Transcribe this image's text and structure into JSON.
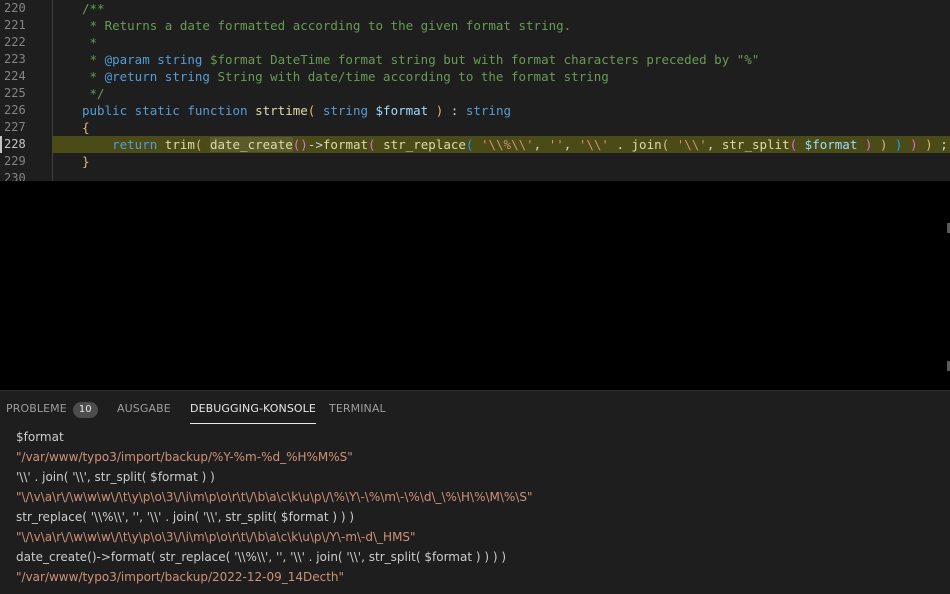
{
  "editor": {
    "lines": [
      {
        "num": "220",
        "segments": [
          {
            "cls": "c-comment",
            "text": "/**"
          }
        ]
      },
      {
        "num": "221",
        "segments": [
          {
            "cls": "c-comment",
            "text": " * Returns a date formatted according to the given format string."
          }
        ]
      },
      {
        "num": "222",
        "segments": [
          {
            "cls": "c-comment",
            "text": " *"
          }
        ]
      },
      {
        "num": "223",
        "segments": [
          {
            "cls": "c-comment",
            "text": " * "
          },
          {
            "cls": "c-doc-tag",
            "text": "@param"
          },
          {
            "cls": "c-comment",
            "text": " "
          },
          {
            "cls": "c-kw",
            "text": "string"
          },
          {
            "cls": "c-comment",
            "text": " $format DateTime format string but with format characters preceded by \"%\""
          }
        ]
      },
      {
        "num": "224",
        "segments": [
          {
            "cls": "c-comment",
            "text": " * "
          },
          {
            "cls": "c-doc-tag",
            "text": "@return"
          },
          {
            "cls": "c-comment",
            "text": " "
          },
          {
            "cls": "c-kw",
            "text": "string"
          },
          {
            "cls": "c-comment",
            "text": " String with date/time according to the format string"
          }
        ]
      },
      {
        "num": "225",
        "segments": [
          {
            "cls": "c-comment",
            "text": " */"
          }
        ]
      },
      {
        "num": "226",
        "segments": [
          {
            "cls": "c-kw",
            "text": "public static function "
          },
          {
            "cls": "c-fn",
            "text": "strtime"
          },
          {
            "cls": "c-brace",
            "text": "( "
          },
          {
            "cls": "c-kw",
            "text": "string "
          },
          {
            "cls": "c-var",
            "text": "$format"
          },
          {
            "cls": "c-brace",
            "text": " )"
          },
          {
            "cls": "c-op",
            "text": " : "
          },
          {
            "cls": "c-kw",
            "text": "string"
          }
        ]
      },
      {
        "num": "227",
        "segments": [
          {
            "cls": "c-brace",
            "text": "{"
          }
        ]
      },
      {
        "num": "228",
        "highlight": true,
        "segments": [
          {
            "cls": "c-op",
            "text": "    "
          },
          {
            "cls": "c-kw",
            "text": "return "
          },
          {
            "cls": "c-fn",
            "text": "trim"
          },
          {
            "cls": "c-brace",
            "text": "( "
          },
          {
            "cls": "c-fn hl-word",
            "text": "date_create"
          },
          {
            "cls": "c-brace2",
            "text": "()"
          },
          {
            "cls": "c-op",
            "text": "->"
          },
          {
            "cls": "c-fn",
            "text": "format"
          },
          {
            "cls": "c-brace2",
            "text": "( "
          },
          {
            "cls": "c-fn",
            "text": "str_replace"
          },
          {
            "cls": "c-brace3",
            "text": "( "
          },
          {
            "cls": "c-str",
            "text": "'\\\\%\\\\'"
          },
          {
            "cls": "c-op",
            "text": ", "
          },
          {
            "cls": "c-str",
            "text": "''"
          },
          {
            "cls": "c-op",
            "text": ", "
          },
          {
            "cls": "c-str",
            "text": "'\\\\'"
          },
          {
            "cls": "c-op",
            "text": " . "
          },
          {
            "cls": "c-fn",
            "text": "join"
          },
          {
            "cls": "c-brace",
            "text": "( "
          },
          {
            "cls": "c-str",
            "text": "'\\\\'"
          },
          {
            "cls": "c-op",
            "text": ", "
          },
          {
            "cls": "c-fn",
            "text": "str_split"
          },
          {
            "cls": "c-brace2",
            "text": "( "
          },
          {
            "cls": "c-var",
            "text": "$format"
          },
          {
            "cls": "c-brace2",
            "text": " )"
          },
          {
            "cls": "c-brace",
            "text": " )"
          },
          {
            "cls": "c-brace3",
            "text": " )"
          },
          {
            "cls": "c-brace2",
            "text": " )"
          },
          {
            "cls": "c-brace",
            "text": " )"
          },
          {
            "cls": "c-op",
            "text": " ;"
          }
        ]
      },
      {
        "num": "229",
        "segments": [
          {
            "cls": "c-brace",
            "text": "}"
          }
        ]
      },
      {
        "num": "230",
        "segments": []
      }
    ]
  },
  "panel": {
    "tabs": [
      {
        "label": "PROBLEME",
        "badge": "10",
        "active": false
      },
      {
        "label": "AUSGABE",
        "active": false
      },
      {
        "label": "DEBUGGING-KONSOLE",
        "active": true
      },
      {
        "label": "TERMINAL",
        "active": false
      }
    ],
    "console": [
      {
        "type": "input",
        "text": "$format"
      },
      {
        "type": "output",
        "text": "\"/var/www/typo3/import/backup/%Y-%m-%d_%H%M%S\""
      },
      {
        "type": "input",
        "text": "'\\\\' . join( '\\\\', str_split( $format ) )"
      },
      {
        "type": "output",
        "text": "\"\\/\\v\\a\\r\\/\\w\\w\\w\\/\\t\\y\\p\\o\\3\\/\\i\\m\\p\\o\\r\\t\\/\\b\\a\\c\\k\\u\\p\\/\\%\\Y\\-\\%\\m\\-\\%\\d\\_\\%\\H\\%\\M\\%\\S\""
      },
      {
        "type": "input",
        "text": "str_replace( '\\\\%\\\\', '', '\\\\' . join( '\\\\', str_split( $format ) ) )"
      },
      {
        "type": "output",
        "text": "\"\\/\\v\\a\\r\\/\\w\\w\\w\\/\\t\\y\\p\\o\\3\\/\\i\\m\\p\\o\\r\\t\\/\\b\\a\\c\\k\\u\\p\\/Y\\-m\\-d\\_HMS\""
      },
      {
        "type": "input",
        "text": "date_create()->format( str_replace( '\\\\%\\\\', '', '\\\\' . join( '\\\\', str_split( $format ) ) ) )"
      },
      {
        "type": "output",
        "text": "\"/var/www/typo3/import/backup/2022-12-09_14Decth\""
      }
    ]
  }
}
